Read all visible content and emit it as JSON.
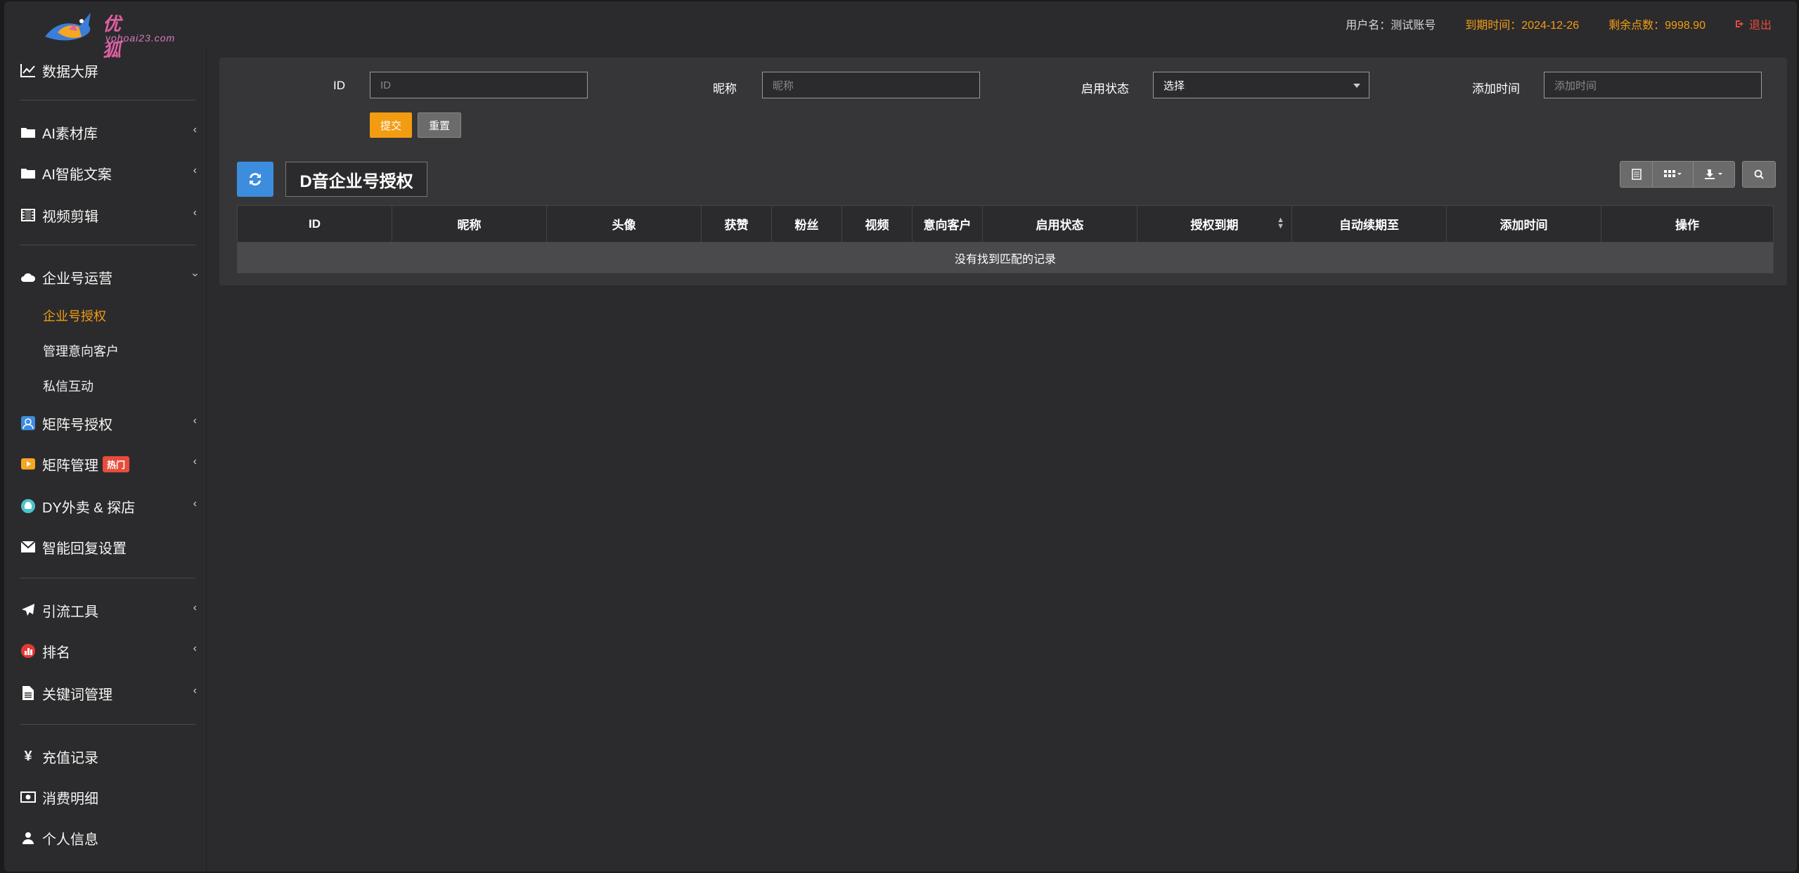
{
  "header": {
    "logo_text": "优狐",
    "logo_sub": "yohoai23.com",
    "user_label": "用户名：测试账号",
    "expire_label": "到期时间：2024-12-26",
    "points_label": "剩余点数：9998.90",
    "logout_label": "退出"
  },
  "sidebar": {
    "items": [
      {
        "label": "数据大屏",
        "icon": "chart-line-icon"
      },
      {
        "label": "AI素材库",
        "icon": "folder-icon"
      },
      {
        "label": "AI智能文案",
        "icon": "folder-icon"
      },
      {
        "label": "视频剪辑",
        "icon": "film-icon"
      },
      {
        "label": "企业号运营",
        "icon": "cloud-icon"
      },
      {
        "label": "矩阵号授权",
        "icon": "contact-book-icon"
      },
      {
        "label": "矩阵管理",
        "icon": "video-play-icon",
        "badge": "热门"
      },
      {
        "label": "DY外卖 & 探店",
        "icon": "food-icon"
      },
      {
        "label": "智能回复设置",
        "icon": "envelope-icon"
      },
      {
        "label": "引流工具",
        "icon": "paper-plane-icon"
      },
      {
        "label": "排名",
        "icon": "bar-chart-icon"
      },
      {
        "label": "关键词管理",
        "icon": "file-icon"
      },
      {
        "label": "充值记录",
        "icon": "yen-icon"
      },
      {
        "label": "消费明细",
        "icon": "money-icon"
      },
      {
        "label": "个人信息",
        "icon": "user-icon"
      }
    ],
    "subitems": [
      {
        "label": "企业号授权",
        "active": true
      },
      {
        "label": "管理意向客户",
        "active": false
      },
      {
        "label": "私信互动",
        "active": false
      }
    ]
  },
  "filters": {
    "id_label": "ID",
    "id_placeholder": "ID",
    "nickname_label": "昵称",
    "nickname_placeholder": "昵称",
    "status_label": "启用状态",
    "status_value": "选择",
    "added_label": "添加时间",
    "added_placeholder": "添加时间",
    "submit_label": "提交",
    "reset_label": "重置"
  },
  "table": {
    "title": "D音企业号授权",
    "columns": [
      "ID",
      "昵称",
      "头像",
      "获赞",
      "粉丝",
      "视频",
      "意向客户",
      "启用状态",
      "授权到期",
      "自动续期至",
      "添加时间",
      "操作"
    ],
    "empty_text": "没有找到匹配的记录"
  },
  "colors": {
    "accent": "#f39c12",
    "primary": "#3c8dde",
    "danger": "#e74c3c",
    "background": "#2b2b2d"
  }
}
